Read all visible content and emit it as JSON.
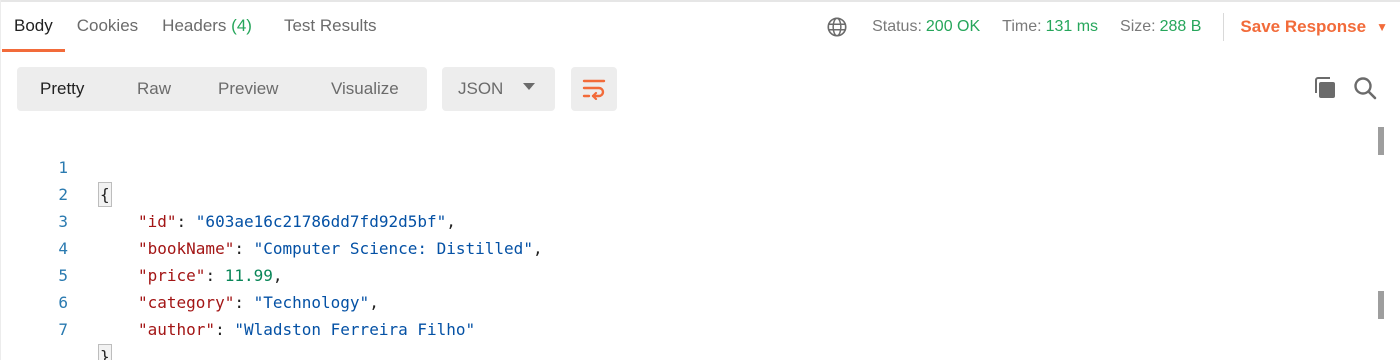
{
  "tabs": [
    {
      "label": "Body"
    },
    {
      "label": "Cookies"
    },
    {
      "label": "Headers",
      "count": "(4)"
    },
    {
      "label": "Test Results"
    }
  ],
  "status": {
    "status_label": "Status:",
    "status_value": "200 OK",
    "time_label": "Time:",
    "time_value": "131 ms",
    "size_label": "Size:",
    "size_value": "288 B"
  },
  "save_response": {
    "label": "Save Response",
    "caret": "▼"
  },
  "view_modes": [
    "Pretty",
    "Raw",
    "Preview",
    "Visualize"
  ],
  "format": {
    "selected": "JSON"
  },
  "code": {
    "line_numbers": [
      "1",
      "2",
      "3",
      "4",
      "5",
      "6",
      "7"
    ],
    "open_brace": "{",
    "close_brace": "}",
    "fields": [
      {
        "key": "\"id\"",
        "value": "\"603ae16c21786dd7fd92d5bf\"",
        "comma": ","
      },
      {
        "key": "\"bookName\"",
        "value": "\"Computer Science: Distilled\"",
        "comma": ","
      },
      {
        "key": "\"price\"",
        "value": "11.99",
        "comma": ","
      },
      {
        "key": "\"category\"",
        "value": "\"Technology\"",
        "comma": ","
      },
      {
        "key": "\"author\"",
        "value": "\"Wladston Ferreira Filho\"",
        "comma": ""
      }
    ],
    "colon": ": "
  },
  "colors": {
    "accent": "#f26b3a",
    "success": "#26a65b",
    "json_key": "#a31515",
    "json_string": "#0451a5",
    "json_number": "#098658",
    "line_number": "#2a7ab0"
  },
  "icons": {
    "globe": "globe-icon",
    "wrap": "wrap-lines-icon",
    "copy": "copy-icon",
    "search": "search-icon"
  }
}
